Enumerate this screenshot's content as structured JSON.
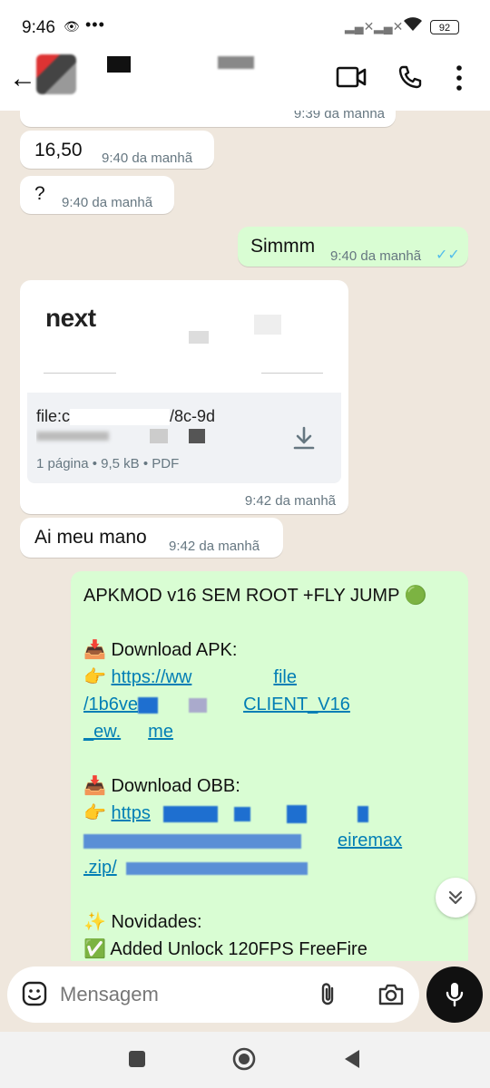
{
  "status_bar": {
    "time": "9:46",
    "battery": "92"
  },
  "chat": {
    "messages": [
      {
        "text": "",
        "time": "9:39 da manhã"
      },
      {
        "text": "16,50",
        "time": "9:40 da manhã"
      },
      {
        "text": "?",
        "time": "9:40 da manhã"
      },
      {
        "text": "Simmm",
        "time": "9:40 da manhã"
      },
      {
        "doc_logo": "next",
        "file_name": "file:c",
        "file_name_end": "/8c-9d",
        "file_meta": "1 página • 9,5 kB • PDF",
        "time": "9:42 da manhã"
      },
      {
        "text": "Ai meu mano",
        "time": "9:42 da manhã"
      }
    ],
    "apk_message": {
      "title": "APKMOD v16 SEM ROOT +FLY JUMP 🟢",
      "download_apk_label": "📥 Download APK:",
      "apk_link_1": "https://ww",
      "apk_link_1_end": "file",
      "apk_link_2": "/1b6ve",
      "apk_link_2_end": "CLIENT_V16",
      "apk_link_3": "_ew.",
      "apk_link_3_end": "me",
      "download_obb_label": "📥 Download OBB:",
      "obb_link_1": "https",
      "obb_link_2_end": "eiremax",
      "obb_link_3": ".zip/",
      "novidades_label": "✨ Novidades:",
      "added_line": "✅ Added Unlock 120FPS FreeFire"
    }
  },
  "input_bar": {
    "placeholder": "Mensagem"
  }
}
